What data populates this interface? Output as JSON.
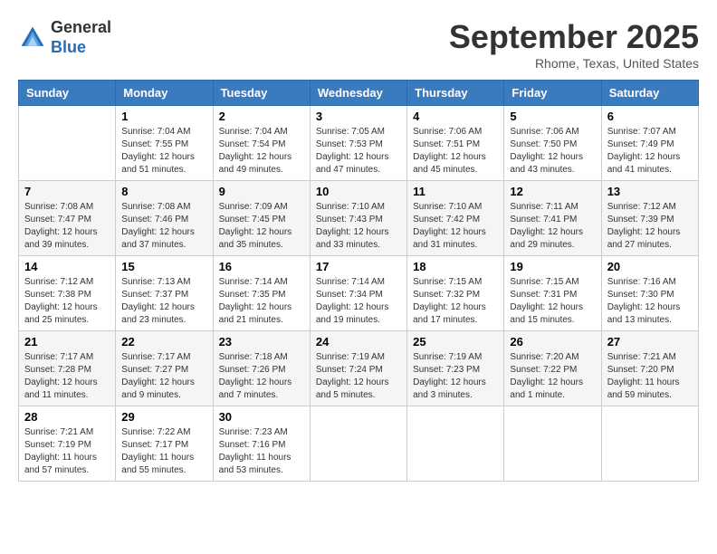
{
  "header": {
    "logo_line1": "General",
    "logo_line2": "Blue",
    "month": "September 2025",
    "location": "Rhome, Texas, United States"
  },
  "weekdays": [
    "Sunday",
    "Monday",
    "Tuesday",
    "Wednesday",
    "Thursday",
    "Friday",
    "Saturday"
  ],
  "weeks": [
    [
      {
        "day": "",
        "sunrise": "",
        "sunset": "",
        "daylight": ""
      },
      {
        "day": "1",
        "sunrise": "Sunrise: 7:04 AM",
        "sunset": "Sunset: 7:55 PM",
        "daylight": "Daylight: 12 hours and 51 minutes."
      },
      {
        "day": "2",
        "sunrise": "Sunrise: 7:04 AM",
        "sunset": "Sunset: 7:54 PM",
        "daylight": "Daylight: 12 hours and 49 minutes."
      },
      {
        "day": "3",
        "sunrise": "Sunrise: 7:05 AM",
        "sunset": "Sunset: 7:53 PM",
        "daylight": "Daylight: 12 hours and 47 minutes."
      },
      {
        "day": "4",
        "sunrise": "Sunrise: 7:06 AM",
        "sunset": "Sunset: 7:51 PM",
        "daylight": "Daylight: 12 hours and 45 minutes."
      },
      {
        "day": "5",
        "sunrise": "Sunrise: 7:06 AM",
        "sunset": "Sunset: 7:50 PM",
        "daylight": "Daylight: 12 hours and 43 minutes."
      },
      {
        "day": "6",
        "sunrise": "Sunrise: 7:07 AM",
        "sunset": "Sunset: 7:49 PM",
        "daylight": "Daylight: 12 hours and 41 minutes."
      }
    ],
    [
      {
        "day": "7",
        "sunrise": "Sunrise: 7:08 AM",
        "sunset": "Sunset: 7:47 PM",
        "daylight": "Daylight: 12 hours and 39 minutes."
      },
      {
        "day": "8",
        "sunrise": "Sunrise: 7:08 AM",
        "sunset": "Sunset: 7:46 PM",
        "daylight": "Daylight: 12 hours and 37 minutes."
      },
      {
        "day": "9",
        "sunrise": "Sunrise: 7:09 AM",
        "sunset": "Sunset: 7:45 PM",
        "daylight": "Daylight: 12 hours and 35 minutes."
      },
      {
        "day": "10",
        "sunrise": "Sunrise: 7:10 AM",
        "sunset": "Sunset: 7:43 PM",
        "daylight": "Daylight: 12 hours and 33 minutes."
      },
      {
        "day": "11",
        "sunrise": "Sunrise: 7:10 AM",
        "sunset": "Sunset: 7:42 PM",
        "daylight": "Daylight: 12 hours and 31 minutes."
      },
      {
        "day": "12",
        "sunrise": "Sunrise: 7:11 AM",
        "sunset": "Sunset: 7:41 PM",
        "daylight": "Daylight: 12 hours and 29 minutes."
      },
      {
        "day": "13",
        "sunrise": "Sunrise: 7:12 AM",
        "sunset": "Sunset: 7:39 PM",
        "daylight": "Daylight: 12 hours and 27 minutes."
      }
    ],
    [
      {
        "day": "14",
        "sunrise": "Sunrise: 7:12 AM",
        "sunset": "Sunset: 7:38 PM",
        "daylight": "Daylight: 12 hours and 25 minutes."
      },
      {
        "day": "15",
        "sunrise": "Sunrise: 7:13 AM",
        "sunset": "Sunset: 7:37 PM",
        "daylight": "Daylight: 12 hours and 23 minutes."
      },
      {
        "day": "16",
        "sunrise": "Sunrise: 7:14 AM",
        "sunset": "Sunset: 7:35 PM",
        "daylight": "Daylight: 12 hours and 21 minutes."
      },
      {
        "day": "17",
        "sunrise": "Sunrise: 7:14 AM",
        "sunset": "Sunset: 7:34 PM",
        "daylight": "Daylight: 12 hours and 19 minutes."
      },
      {
        "day": "18",
        "sunrise": "Sunrise: 7:15 AM",
        "sunset": "Sunset: 7:32 PM",
        "daylight": "Daylight: 12 hours and 17 minutes."
      },
      {
        "day": "19",
        "sunrise": "Sunrise: 7:15 AM",
        "sunset": "Sunset: 7:31 PM",
        "daylight": "Daylight: 12 hours and 15 minutes."
      },
      {
        "day": "20",
        "sunrise": "Sunrise: 7:16 AM",
        "sunset": "Sunset: 7:30 PM",
        "daylight": "Daylight: 12 hours and 13 minutes."
      }
    ],
    [
      {
        "day": "21",
        "sunrise": "Sunrise: 7:17 AM",
        "sunset": "Sunset: 7:28 PM",
        "daylight": "Daylight: 12 hours and 11 minutes."
      },
      {
        "day": "22",
        "sunrise": "Sunrise: 7:17 AM",
        "sunset": "Sunset: 7:27 PM",
        "daylight": "Daylight: 12 hours and 9 minutes."
      },
      {
        "day": "23",
        "sunrise": "Sunrise: 7:18 AM",
        "sunset": "Sunset: 7:26 PM",
        "daylight": "Daylight: 12 hours and 7 minutes."
      },
      {
        "day": "24",
        "sunrise": "Sunrise: 7:19 AM",
        "sunset": "Sunset: 7:24 PM",
        "daylight": "Daylight: 12 hours and 5 minutes."
      },
      {
        "day": "25",
        "sunrise": "Sunrise: 7:19 AM",
        "sunset": "Sunset: 7:23 PM",
        "daylight": "Daylight: 12 hours and 3 minutes."
      },
      {
        "day": "26",
        "sunrise": "Sunrise: 7:20 AM",
        "sunset": "Sunset: 7:22 PM",
        "daylight": "Daylight: 12 hours and 1 minute."
      },
      {
        "day": "27",
        "sunrise": "Sunrise: 7:21 AM",
        "sunset": "Sunset: 7:20 PM",
        "daylight": "Daylight: 11 hours and 59 minutes."
      }
    ],
    [
      {
        "day": "28",
        "sunrise": "Sunrise: 7:21 AM",
        "sunset": "Sunset: 7:19 PM",
        "daylight": "Daylight: 11 hours and 57 minutes."
      },
      {
        "day": "29",
        "sunrise": "Sunrise: 7:22 AM",
        "sunset": "Sunset: 7:17 PM",
        "daylight": "Daylight: 11 hours and 55 minutes."
      },
      {
        "day": "30",
        "sunrise": "Sunrise: 7:23 AM",
        "sunset": "Sunset: 7:16 PM",
        "daylight": "Daylight: 11 hours and 53 minutes."
      },
      {
        "day": "",
        "sunrise": "",
        "sunset": "",
        "daylight": ""
      },
      {
        "day": "",
        "sunrise": "",
        "sunset": "",
        "daylight": ""
      },
      {
        "day": "",
        "sunrise": "",
        "sunset": "",
        "daylight": ""
      },
      {
        "day": "",
        "sunrise": "",
        "sunset": "",
        "daylight": ""
      }
    ]
  ]
}
